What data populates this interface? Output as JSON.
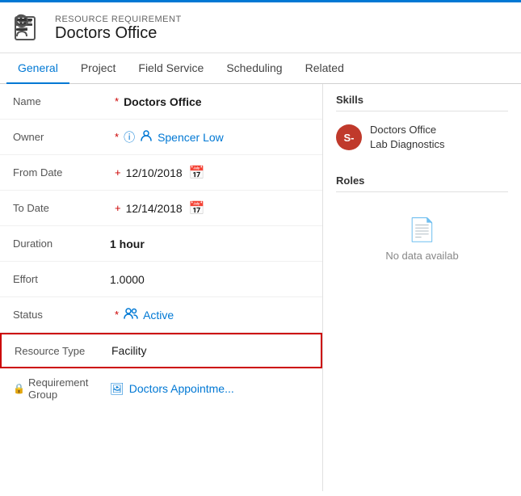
{
  "header": {
    "record_type": "RESOURCE REQUIREMENT",
    "title": "Doctors Office",
    "icon_label": "person-list-icon"
  },
  "nav": {
    "tabs": [
      {
        "id": "general",
        "label": "General",
        "active": true
      },
      {
        "id": "project",
        "label": "Project",
        "active": false
      },
      {
        "id": "field-service",
        "label": "Field Service",
        "active": false
      },
      {
        "id": "scheduling",
        "label": "Scheduling",
        "active": false
      },
      {
        "id": "related",
        "label": "Related",
        "active": false
      }
    ]
  },
  "form": {
    "name_label": "Name",
    "name_value": "Doctors Office",
    "owner_label": "Owner",
    "owner_value": "Spencer Low",
    "from_date_label": "From Date",
    "from_date_value": "12/10/2018",
    "to_date_label": "To Date",
    "to_date_value": "12/14/2018",
    "duration_label": "Duration",
    "duration_value": "1 hour",
    "effort_label": "Effort",
    "effort_value": "1.0000",
    "status_label": "Status",
    "status_value": "Active",
    "resource_type_label": "Resource Type",
    "resource_type_value": "Facility",
    "req_group_label": "Requirement Group",
    "req_group_value": "Doctors Appointme..."
  },
  "skills_panel": {
    "title": "Skills",
    "skill_avatar_initials": "S-",
    "skill_name": "Doctors Office",
    "skill_sub": "Lab Diagnostics"
  },
  "roles_panel": {
    "title": "Roles",
    "no_data_text": "No data availab"
  },
  "colors": {
    "accent": "#0078d4",
    "required": "#c00",
    "avatar_bg": "#c0392b",
    "highlight_border": "#c00"
  }
}
